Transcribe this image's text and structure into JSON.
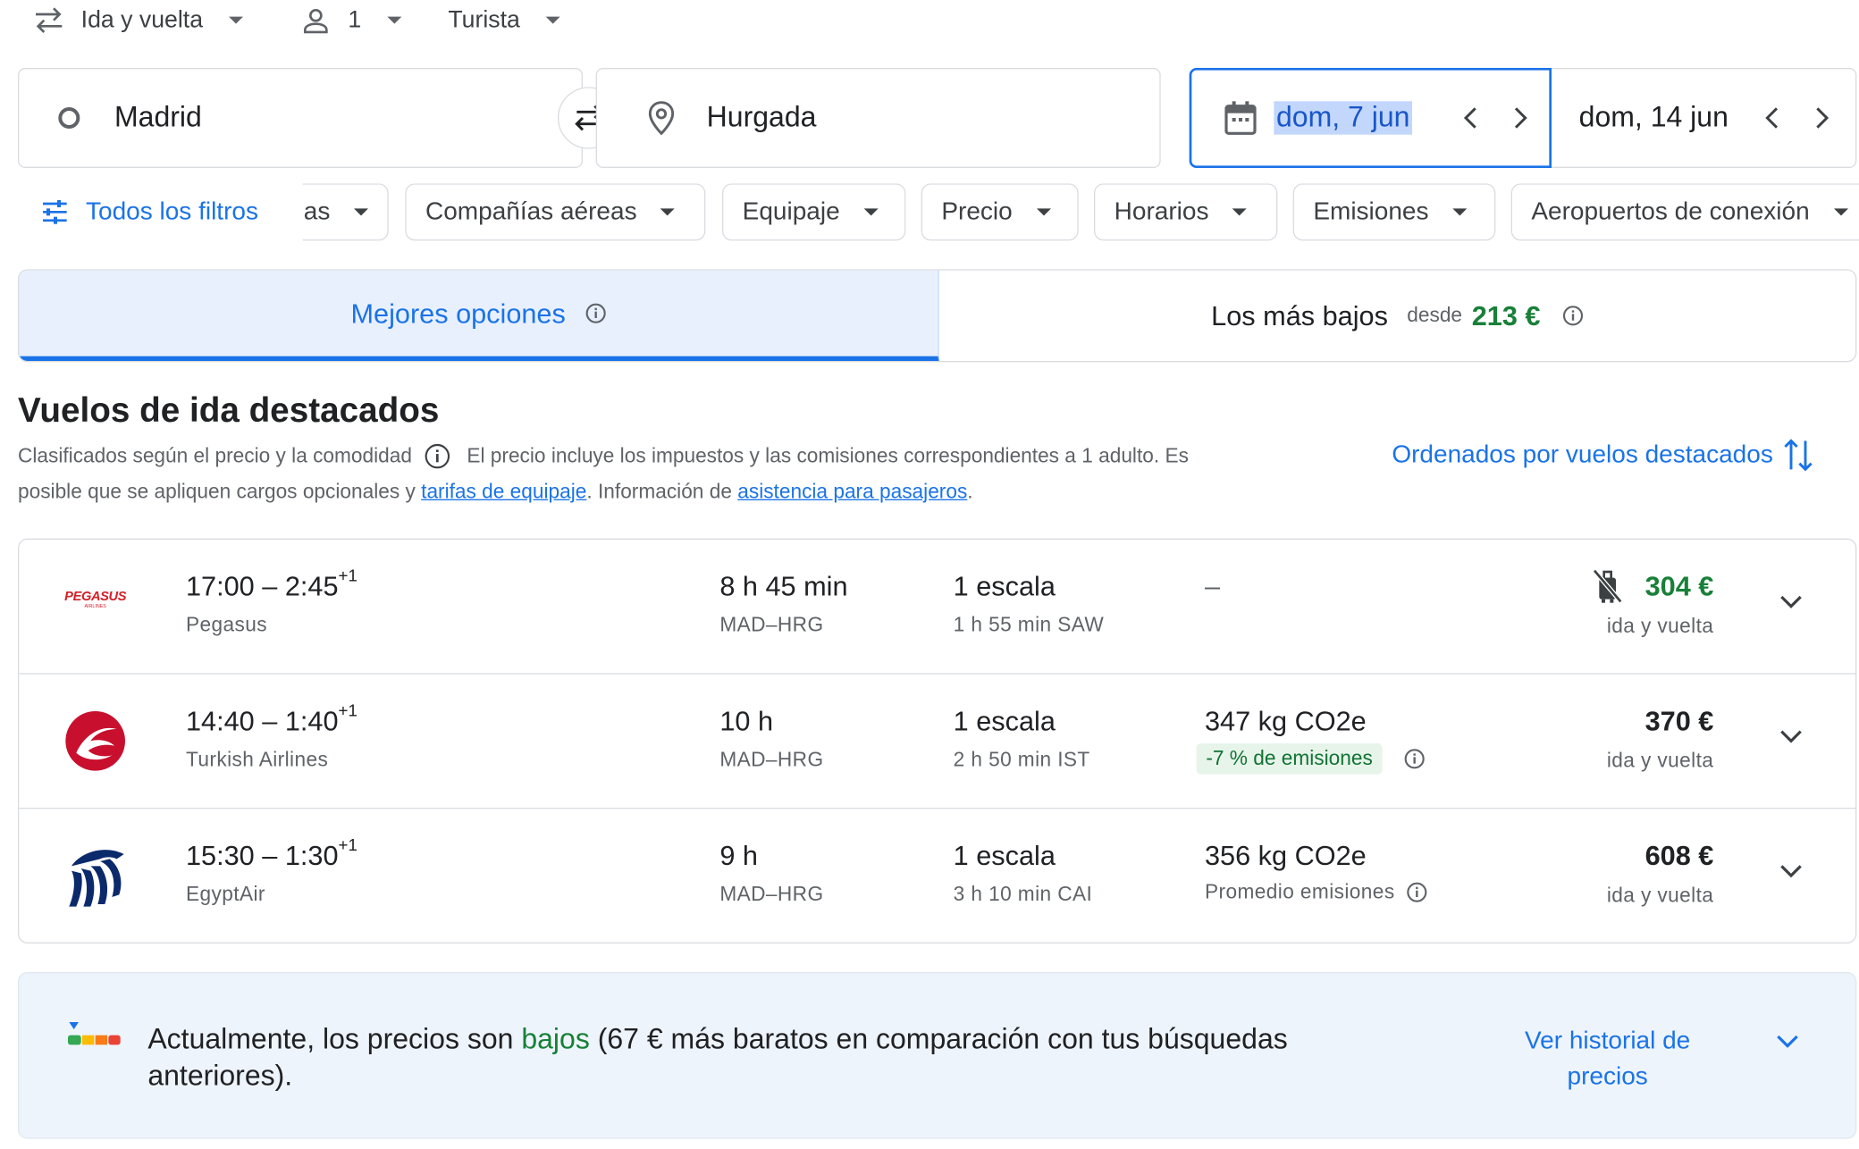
{
  "trip_options": {
    "trip_type": "Ida y vuelta",
    "passengers": "1",
    "cabin_class": "Turista"
  },
  "search": {
    "origin": "Madrid",
    "destination": "Hurgada",
    "departure_date": "dom, 7 jun",
    "return_date": "dom, 14 jun"
  },
  "filters": {
    "all_filters": "Todos los filtros",
    "chips": [
      "as",
      "Compañías aéreas",
      "Equipaje",
      "Precio",
      "Horarios",
      "Emisiones",
      "Aeropuertos de conexión"
    ]
  },
  "tabs": {
    "best": "Mejores opciones",
    "cheapest": "Los más bajos",
    "cheapest_from_label": "desde",
    "cheapest_price": "213 €"
  },
  "results_header": {
    "title": "Vuelos de ida destacados",
    "ranked_by": "Clasificados según el precio y la comodidad",
    "price_note_1": "El precio incluye los impuestos y las comisiones correspondientes a 1 adulto. Es",
    "price_note_2": "posible que se apliquen cargos opcionales y",
    "baggage_fees_link": "tarifas de equipaje",
    "info_text": ". Información de",
    "assistance_link": "asistencia para pasajeros",
    "period": ".",
    "sort_label": "Ordenados por vuelos destacados"
  },
  "flights": [
    {
      "times": "17:00 – 2:45",
      "day_offset": "+1",
      "airline": "Pegasus",
      "logo_text": "PEGASUS",
      "logo_sub": "AIRLINES",
      "duration": "8 h 45 min",
      "route": "MAD–HRG",
      "stops": "1 escala",
      "layover": "1 h 55 min SAW",
      "emissions": "–",
      "emissions_note": "",
      "price": "304 €",
      "price_note": "ida y vuelta"
    },
    {
      "times": "14:40 – 1:40",
      "day_offset": "+1",
      "airline": "Turkish Airlines",
      "duration": "10 h",
      "route": "MAD–HRG",
      "stops": "1 escala",
      "layover": "2 h 50 min IST",
      "emissions": "347 kg CO2e",
      "emissions_note": "-7 % de emisiones",
      "price": "370 €",
      "price_note": "ida y vuelta"
    },
    {
      "times": "15:30 – 1:30",
      "day_offset": "+1",
      "airline": "EgyptAir",
      "duration": "9 h",
      "route": "MAD–HRG",
      "stops": "1 escala",
      "layover": "3 h 10 min CAI",
      "emissions": "356 kg CO2e",
      "emissions_note": "Promedio emisiones",
      "price": "608 €",
      "price_note": "ida y vuelta"
    }
  ],
  "price_insight": {
    "text_before": "Actualmente, los precios son",
    "level": "bajos",
    "text_after": "(67 € más baratos en comparación con tus búsquedas",
    "text_line2": "anteriores).",
    "history_link_1": "Ver historial de",
    "history_link_2": "precios"
  },
  "colors": {
    "accent_blue": "#1a73e8",
    "low_price_green": "#188038",
    "pegasus_red": "#d4202a",
    "turkish_red": "#c8102e",
    "egyptair_navy": "#0b2a6b"
  },
  "icons": [
    "swap-arrows-icon",
    "person-icon",
    "circle-origin-icon",
    "location-pin-icon",
    "calendar-icon",
    "chevron-left-icon",
    "chevron-right-icon",
    "filter-sliders-icon",
    "info-icon",
    "sort-arrows-icon",
    "chevron-down-icon",
    "no-carry-on-bag-icon",
    "price-level-icon"
  ]
}
